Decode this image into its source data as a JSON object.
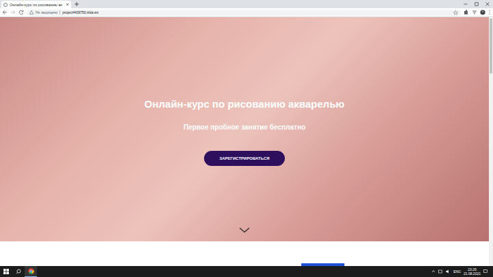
{
  "browser": {
    "tabs": [
      {
        "label": "Онлайн-курс по рисованию ак",
        "selected": true
      }
    ],
    "security": "Не защищено",
    "url": "project4439750.tilda.ws"
  },
  "hero": {
    "title": "Онлайн-курс по рисованию акварелью",
    "subtitle": "Первое пробное занятие бесплатно",
    "button": "ЗАРЕГИСТРИРОВАТЬСЯ"
  },
  "taskbar": {
    "language": "ENG",
    "time": "23:29",
    "date": "21.08.2021"
  }
}
